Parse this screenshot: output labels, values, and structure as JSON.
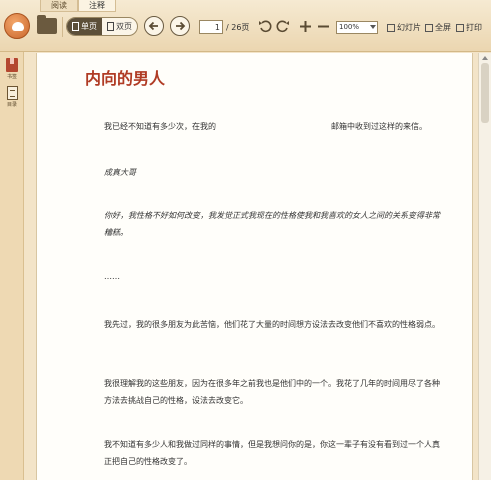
{
  "app": {
    "logo_icon": "reader-logo-icon",
    "accent": "#b03b24",
    "mode_tabs": [
      {
        "label": "阅读",
        "active": false
      },
      {
        "label": "注释",
        "active": true
      }
    ]
  },
  "toolbar": {
    "view_single": "单页",
    "view_double": "双页",
    "current_page": "1",
    "total_pages": "/ 26页",
    "zoom": "100%",
    "slideshow": "幻灯片",
    "fullscreen": "全屏",
    "print": "打印"
  },
  "sidebar": {
    "items": [
      {
        "label": "书签",
        "icon": "bookmark-icon"
      },
      {
        "label": "目录",
        "icon": "toc-icon"
      }
    ]
  },
  "document": {
    "title": "内向的男人",
    "p1_left": "我已经不知道有多少次，在我的",
    "p1_right": "邮箱中收到过这样的来信。",
    "p2": "成真大哥",
    "p3": "你好，我性格不好如何改变，我发觉正式我现在的性格使我和我喜欢的女人之间的关系变得非常糟糕。",
    "p4": "……",
    "p5": "我先过，我的很多朋友为此苦恼，他们花了大量的时间想方设法去改变他们不喜欢的性格弱点。",
    "p6": "我很理解我的这些朋友，因为在很多年之前我也是他们中的一个。我花了几年的时间用尽了各种方法去挑战自己的性格，设法去改变它。",
    "p7": "我不知道有多少人和我做过同样的事情，但是我想问你的是，你这一辈子有没有看到过一个人真正把自己的性格改变了。"
  }
}
